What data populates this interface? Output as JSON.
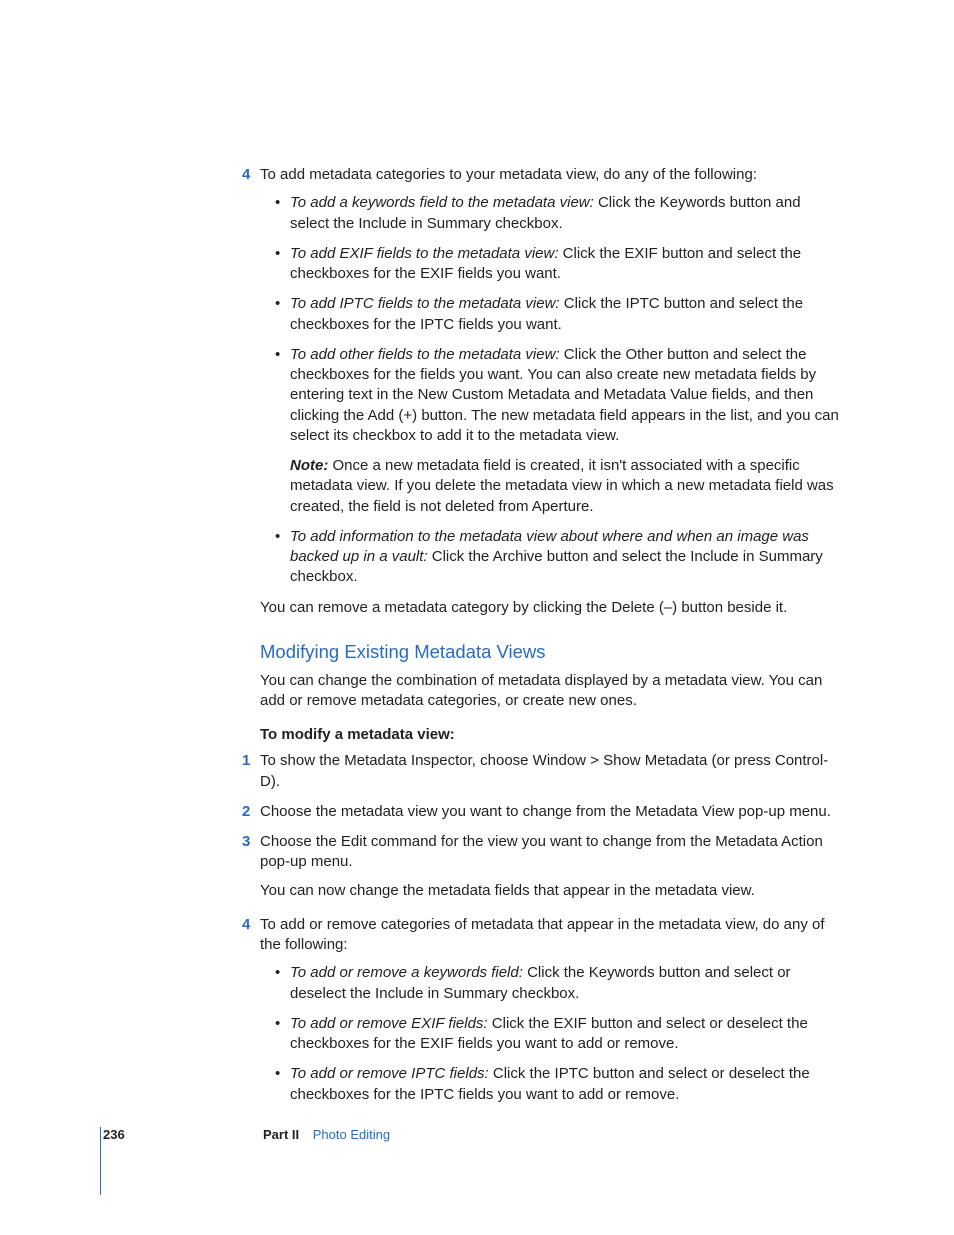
{
  "step4a": {
    "num": "4",
    "intro": "To add metadata categories to your metadata view, do any of the following:",
    "bullets": [
      {
        "lead": "To add a keywords field to the metadata view:",
        "rest": "  Click the Keywords button and select the Include in Summary checkbox."
      },
      {
        "lead": "To add EXIF fields to the metadata view:",
        "rest": "  Click the EXIF button and select the checkboxes for the EXIF fields you want."
      },
      {
        "lead": "To add IPTC fields to the metadata view:",
        "rest": "  Click the IPTC button and select the checkboxes for the IPTC fields you want."
      },
      {
        "lead": "To add other fields to the metadata view:",
        "rest": "  Click the Other button and select the checkboxes for the fields you want. You can also create new metadata fields by entering text in the New Custom Metadata and Metadata Value fields, and then clicking the Add (+) button. The new metadata field appears in the list, and you can select its checkbox to add it to the metadata view."
      }
    ],
    "note_label": "Note:",
    "note_text": "  Once a new metadata field is created, it isn't associated with a specific metadata view. If you delete the metadata view in which a new metadata field was created, the field is not deleted from Aperture.",
    "bullets2": [
      {
        "lead": "To add information to the metadata view about where and when an image was backed up in a vault:",
        "rest": "  Click the Archive button and select the Include in Summary checkbox."
      }
    ],
    "closing": "You can remove a metadata category by clicking the Delete (–) button beside it."
  },
  "section": {
    "title": "Modifying Existing Metadata Views",
    "intro": "You can change the combination of metadata displayed by a metadata view. You can add or remove metadata categories, or create new ones.",
    "subhead": "To modify a metadata view:",
    "steps": [
      {
        "num": "1",
        "text": "To show the Metadata Inspector, choose Window > Show Metadata (or press Control-D)."
      },
      {
        "num": "2",
        "text": "Choose the metadata view you want to change from the Metadata View pop-up menu."
      },
      {
        "num": "3",
        "text": "Choose the Edit command for the view you want to change from the Metadata Action pop-up menu."
      }
    ],
    "step3_after": "You can now change the metadata fields that appear in the metadata view.",
    "step4": {
      "num": "4",
      "intro": "To add or remove categories of metadata that appear in the metadata view, do any of the following:",
      "bullets": [
        {
          "lead": "To add or remove a keywords field:",
          "rest": "  Click the Keywords button and select or deselect the Include in Summary checkbox."
        },
        {
          "lead": "To add or remove EXIF fields:",
          "rest": "  Click the EXIF button and select or deselect the checkboxes for the EXIF fields you want to add or remove."
        },
        {
          "lead": "To add or remove IPTC fields:",
          "rest": "  Click the IPTC button and select or deselect the checkboxes for the IPTC fields you want to add or remove."
        }
      ]
    }
  },
  "footer": {
    "page": "236",
    "part": "Part II",
    "title": "Photo Editing"
  }
}
